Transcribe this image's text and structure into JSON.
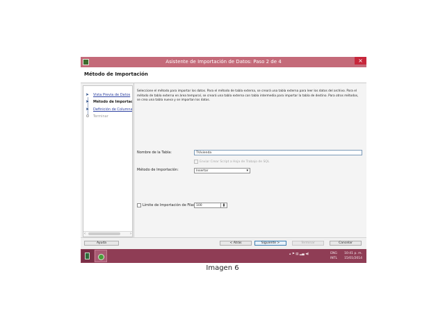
{
  "window": {
    "title": "Asistente de Importación de Datos: Paso 2 de 4",
    "close": "×"
  },
  "header": {
    "title": "Método de Importación"
  },
  "steps": [
    {
      "label": "Vista Previa de Datos",
      "state": "link"
    },
    {
      "label": "Método de Importac",
      "state": "current"
    },
    {
      "label": "Definición de Columna",
      "state": "link"
    },
    {
      "label": "Terminar",
      "state": "disabled"
    }
  ],
  "scroll": {
    "left": "‹",
    "right": "›"
  },
  "main": {
    "description": "Seleccione el método para importar los datos.  Para el método de tabla externa, se creará una tabla externa para leer los datos del archivo. Para el método de tabla externa en área temporal, se creará una tabla externa con tabla intermedia para importar la tabla de destino. Para otros métodos, se crea una tabla nueva y se importan los datos.",
    "method_label": "Método de Importación:",
    "method_value": "Insertar",
    "table_label": "Nombre de la Tabla:",
    "table_value": "TVivienda",
    "sql_label": "Enviar Crear Script a Hoja de Trabajo de SQL",
    "limit_label": "Límite de Importación de Filas:",
    "limit_value": "100"
  },
  "buttons": {
    "help": "Ayuda",
    "back": "< Atrás",
    "next": "Siguiente >",
    "finish": "Terminar",
    "cancel": "Cancelar"
  },
  "taskbar": {
    "lang_top": "ENG",
    "lang_bottom": "INTL",
    "time": "10:41 p. m.",
    "date": "15/01/2014"
  },
  "caption": "Imagen 6"
}
